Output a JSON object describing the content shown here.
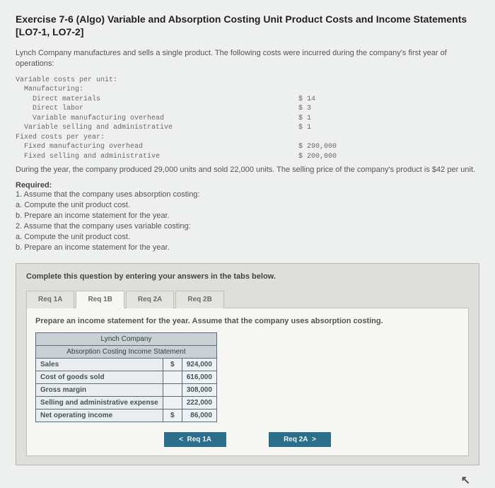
{
  "title": "Exercise 7-6 (Algo) Variable and Absorption Costing Unit Product Costs and Income Statements [LO7-1, LO7-2]",
  "intro": "Lynch Company manufactures and sells a single product. The following costs were incurred during the company's first year of operations:",
  "costs": {
    "heading_var": "Variable costs per unit:",
    "heading_mfg": "  Manufacturing:",
    "dm_label": "    Direct materials",
    "dm_val": "$ 14",
    "dl_label": "    Direct labor",
    "dl_val": "$ 3",
    "vmoh_label": "    Variable manufacturing overhead",
    "vmoh_val": "$ 1",
    "vsga_label": "  Variable selling and administrative",
    "vsga_val": "$ 1",
    "heading_fix": "Fixed costs per year:",
    "fmoh_label": "  Fixed manufacturing overhead",
    "fmoh_val": "$ 290,000",
    "fsga_label": "  Fixed selling and administrative",
    "fsga_val": "$ 200,000"
  },
  "after_costs": "During the year, the company produced 29,000 units and sold 22,000 units. The selling price of the company's product is $42 per unit.",
  "required_label": "Required:",
  "required_lines": {
    "l1": "1. Assume that the company uses absorption costing:",
    "l1a": "a. Compute the unit product cost.",
    "l1b": "b. Prepare an income statement for the year.",
    "l2": "2. Assume that the company uses variable costing:",
    "l2a": "a. Compute the unit product cost.",
    "l2b": "b. Prepare an income statement for the year."
  },
  "prompt": "Complete this question by entering your answers in the tabs below.",
  "tabs": {
    "t1": "Req 1A",
    "t2": "Req 1B",
    "t3": "Req 2A",
    "t4": "Req 2B"
  },
  "tab_note": "Prepare an income statement for the year. Assume that the company uses absorption costing.",
  "stmt": {
    "head1": "Lynch Company",
    "head2": "Absorption Costing Income Statement",
    "rows": {
      "sales_l": "Sales",
      "sales_v": "924,000",
      "cogs_l": "Cost of goods sold",
      "cogs_v": "616,000",
      "gm_l": "Gross margin",
      "gm_v": "308,000",
      "sga_l": "Selling and administrative expense",
      "sga_v": "222,000",
      "noi_l": "Net operating income",
      "noi_v": "86,000"
    },
    "dollar": "$"
  },
  "nav": {
    "prev": "Req 1A",
    "next": "Req 2A"
  }
}
